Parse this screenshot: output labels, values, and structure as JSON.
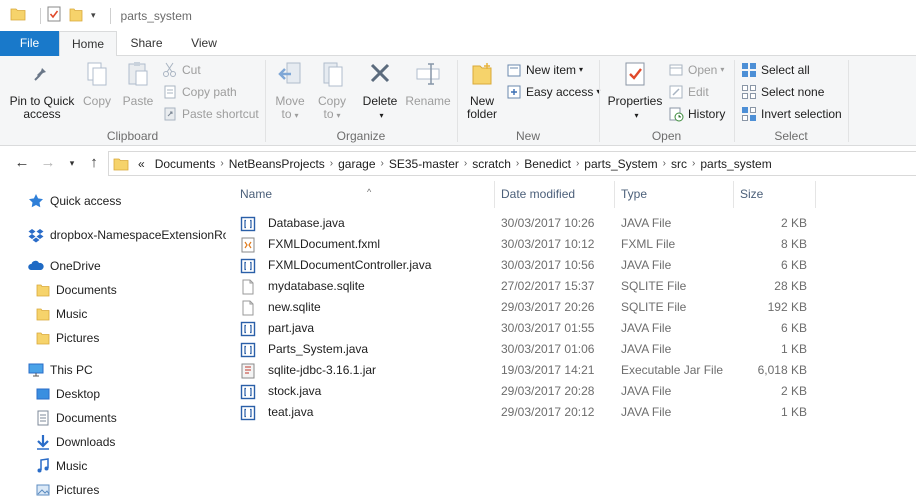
{
  "window": {
    "title": "parts_system"
  },
  "ribbon_tabs": {
    "file": "File",
    "home": "Home",
    "share": "Share",
    "view": "View"
  },
  "ribbon": {
    "clipboard": {
      "label": "Clipboard",
      "pin_line1": "Pin to Quick",
      "pin_line2": "access",
      "copy": "Copy",
      "paste": "Paste",
      "cut": "Cut",
      "copy_path": "Copy path",
      "paste_shortcut": "Paste shortcut"
    },
    "organize": {
      "label": "Organize",
      "move_to_line1": "Move",
      "move_to_line2": "to",
      "copy_to_line1": "Copy",
      "copy_to_line2": "to",
      "delete": "Delete",
      "rename": "Rename"
    },
    "new": {
      "label": "New",
      "new_folder_line1": "New",
      "new_folder_line2": "folder",
      "new_item": "New item",
      "easy_access": "Easy access"
    },
    "open": {
      "label": "Open",
      "properties": "Properties",
      "open": "Open",
      "edit": "Edit",
      "history": "History"
    },
    "select": {
      "label": "Select",
      "select_all": "Select all",
      "select_none": "Select none",
      "invert_selection": "Invert selection"
    }
  },
  "address": {
    "overflow": "«",
    "crumbs": [
      "Documents",
      "NetBeansProjects",
      "garage",
      "SE35-master",
      "scratch",
      "Benedict",
      "parts_System",
      "src",
      "parts_system"
    ]
  },
  "nav": {
    "quick_access": "Quick access",
    "dropbox": "dropbox-NamespaceExtensionRo",
    "onedrive": "OneDrive",
    "onedrive_items": [
      "Documents",
      "Music",
      "Pictures"
    ],
    "this_pc": "This PC",
    "pc_items": [
      "Desktop",
      "Documents",
      "Downloads",
      "Music",
      "Pictures"
    ]
  },
  "columns": {
    "name": "Name",
    "date": "Date modified",
    "type": "Type",
    "size": "Size"
  },
  "files": [
    {
      "name": "Database.java",
      "date": "30/03/2017 10:26",
      "type": "JAVA File",
      "size": "2 KB",
      "icon": "java-file-icon"
    },
    {
      "name": "FXMLDocument.fxml",
      "date": "30/03/2017 10:12",
      "type": "FXML File",
      "size": "8 KB",
      "icon": "fxml-file-icon"
    },
    {
      "name": "FXMLDocumentController.java",
      "date": "30/03/2017 10:56",
      "type": "JAVA File",
      "size": "6 KB",
      "icon": "java-file-icon"
    },
    {
      "name": "mydatabase.sqlite",
      "date": "27/02/2017 15:37",
      "type": "SQLITE File",
      "size": "28 KB",
      "icon": "generic-file-icon"
    },
    {
      "name": "new.sqlite",
      "date": "29/03/2017 20:26",
      "type": "SQLITE File",
      "size": "192 KB",
      "icon": "generic-file-icon"
    },
    {
      "name": "part.java",
      "date": "30/03/2017 01:55",
      "type": "JAVA File",
      "size": "6 KB",
      "icon": "java-file-icon"
    },
    {
      "name": "Parts_System.java",
      "date": "30/03/2017 01:06",
      "type": "JAVA File",
      "size": "1 KB",
      "icon": "java-file-icon"
    },
    {
      "name": "sqlite-jdbc-3.16.1.jar",
      "date": "19/03/2017 14:21",
      "type": "Executable Jar File",
      "size": "6,018 KB",
      "icon": "jar-file-icon"
    },
    {
      "name": "stock.java",
      "date": "29/03/2017 20:28",
      "type": "JAVA File",
      "size": "2 KB",
      "icon": "java-file-icon"
    },
    {
      "name": "teat.java",
      "date": "29/03/2017 20:12",
      "type": "JAVA File",
      "size": "1 KB",
      "icon": "java-file-icon"
    }
  ],
  "colors": {
    "file_tab": "#1979ca",
    "ribbon_bg": "#f5f6f7",
    "folder": "#f6d36b"
  }
}
